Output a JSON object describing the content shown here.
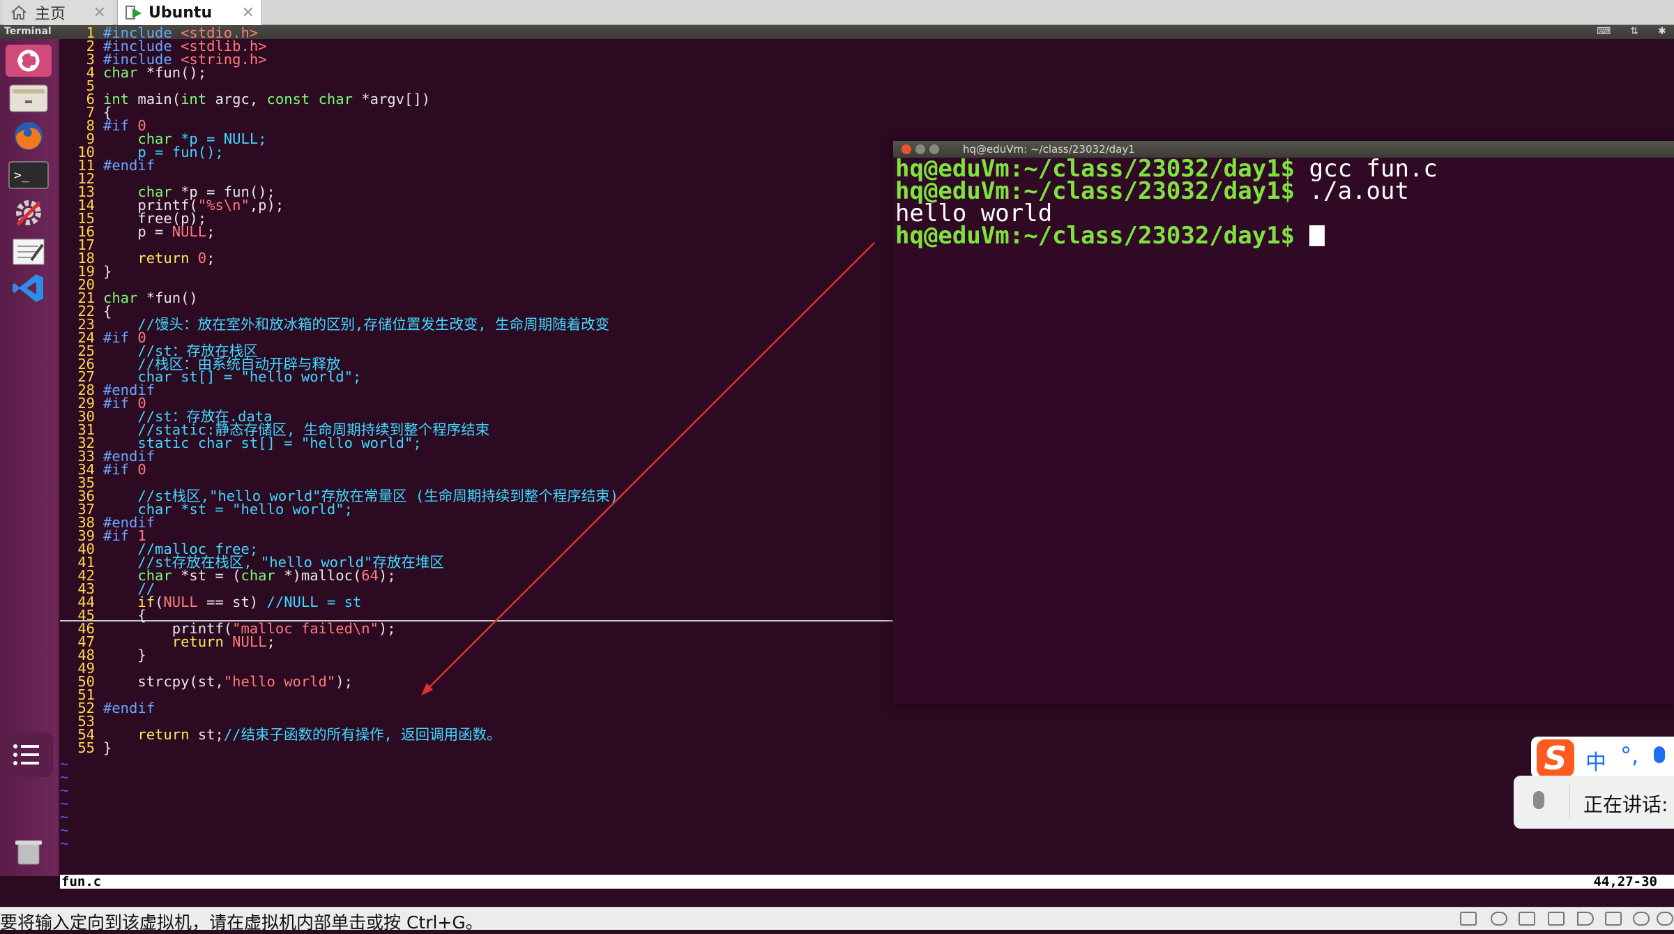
{
  "tabs": [
    {
      "label": "主页",
      "active": false
    },
    {
      "label": "Ubuntu",
      "active": true
    }
  ],
  "top_panel": {
    "title": "Terminal"
  },
  "launcher": {
    "items": [
      "ubuntu-dash-icon",
      "files-icon",
      "firefox-icon",
      "terminal-icon",
      "settings-icon",
      "text-editor-icon",
      "vscode-icon",
      "trash-icon"
    ]
  },
  "vim": {
    "lines": [
      {
        "n": "1",
        "spans": [
          {
            "t": "#include ",
            "c": "pre"
          },
          {
            "t": "<stdio.h>",
            "c": "str"
          }
        ]
      },
      {
        "n": "2",
        "spans": [
          {
            "t": "#include ",
            "c": "pre"
          },
          {
            "t": "<stdlib.h>",
            "c": "str"
          }
        ]
      },
      {
        "n": "3",
        "spans": [
          {
            "t": "#include ",
            "c": "pre"
          },
          {
            "t": "<string.h>",
            "c": "str"
          }
        ]
      },
      {
        "n": "4",
        "spans": [
          {
            "t": "char",
            "c": "type"
          },
          {
            "t": " *fun();",
            "c": ""
          }
        ]
      },
      {
        "n": "5",
        "spans": []
      },
      {
        "n": "6",
        "spans": [
          {
            "t": "int",
            "c": "type"
          },
          {
            "t": " main(",
            "c": ""
          },
          {
            "t": "int",
            "c": "type"
          },
          {
            "t": " argc, ",
            "c": ""
          },
          {
            "t": "const char",
            "c": "type"
          },
          {
            "t": " *argv[])",
            "c": ""
          }
        ]
      },
      {
        "n": "7",
        "spans": [
          {
            "t": "{",
            "c": ""
          }
        ]
      },
      {
        "n": "8",
        "spans": [
          {
            "t": "#if ",
            "c": "pre"
          },
          {
            "t": "0",
            "c": "str"
          }
        ]
      },
      {
        "n": "9",
        "spans": [
          {
            "t": "    ",
            "c": ""
          },
          {
            "t": "char",
            "c": "type"
          },
          {
            "t": " *p = NULL;",
            "c": "com"
          }
        ]
      },
      {
        "n": "10",
        "spans": [
          {
            "t": "    p = fun();",
            "c": "com"
          }
        ]
      },
      {
        "n": "11",
        "spans": [
          {
            "t": "#endif",
            "c": "pre"
          }
        ]
      },
      {
        "n": "12",
        "spans": []
      },
      {
        "n": "13",
        "spans": [
          {
            "t": "    ",
            "c": ""
          },
          {
            "t": "char",
            "c": "type"
          },
          {
            "t": " *p = fun();",
            "c": ""
          }
        ]
      },
      {
        "n": "14",
        "spans": [
          {
            "t": "    printf(",
            "c": ""
          },
          {
            "t": "\"%s\\n\"",
            "c": "str"
          },
          {
            "t": ",p);",
            "c": ""
          }
        ]
      },
      {
        "n": "15",
        "spans": [
          {
            "t": "    free(p);",
            "c": ""
          }
        ]
      },
      {
        "n": "16",
        "spans": [
          {
            "t": "    p = ",
            "c": ""
          },
          {
            "t": "NULL",
            "c": "str"
          },
          {
            "t": ";",
            "c": ""
          }
        ]
      },
      {
        "n": "17",
        "spans": []
      },
      {
        "n": "18",
        "spans": [
          {
            "t": "    ",
            "c": ""
          },
          {
            "t": "return",
            "c": "kw"
          },
          {
            "t": " ",
            "c": ""
          },
          {
            "t": "0",
            "c": "str"
          },
          {
            "t": ";",
            "c": ""
          }
        ]
      },
      {
        "n": "19",
        "spans": [
          {
            "t": "}",
            "c": ""
          }
        ]
      },
      {
        "n": "20",
        "spans": []
      },
      {
        "n": "21",
        "spans": [
          {
            "t": "char",
            "c": "type"
          },
          {
            "t": " *fun()",
            "c": ""
          }
        ]
      },
      {
        "n": "22",
        "spans": [
          {
            "t": "{",
            "c": ""
          }
        ]
      },
      {
        "n": "23",
        "spans": [
          {
            "t": "    //馒头：放在室外和放冰箱的区别,存储位置发生改变, 生命周期随着改变",
            "c": "com"
          }
        ]
      },
      {
        "n": "24",
        "spans": [
          {
            "t": "#if ",
            "c": "pre"
          },
          {
            "t": "0",
            "c": "str"
          }
        ]
      },
      {
        "n": "25",
        "spans": [
          {
            "t": "    //st：存放在栈区",
            "c": "com"
          }
        ]
      },
      {
        "n": "26",
        "spans": [
          {
            "t": "    //栈区：由系统自动开辟与释放",
            "c": "com"
          }
        ]
      },
      {
        "n": "27",
        "spans": [
          {
            "t": "    char st[] = \"hello world\";",
            "c": "com"
          }
        ]
      },
      {
        "n": "28",
        "spans": [
          {
            "t": "#endif",
            "c": "pre"
          }
        ]
      },
      {
        "n": "29",
        "spans": [
          {
            "t": "#if ",
            "c": "pre"
          },
          {
            "t": "0",
            "c": "str"
          }
        ]
      },
      {
        "n": "30",
        "spans": [
          {
            "t": "    //st：存放在.data",
            "c": "com"
          }
        ]
      },
      {
        "n": "31",
        "spans": [
          {
            "t": "    //static:静态存储区, 生命周期持续到整个程序结束",
            "c": "com"
          }
        ]
      },
      {
        "n": "32",
        "spans": [
          {
            "t": "    static char st[] = \"hello world\";",
            "c": "com"
          }
        ]
      },
      {
        "n": "33",
        "spans": [
          {
            "t": "#endif",
            "c": "pre"
          }
        ]
      },
      {
        "n": "34",
        "spans": [
          {
            "t": "#if ",
            "c": "pre"
          },
          {
            "t": "0",
            "c": "str"
          }
        ]
      },
      {
        "n": "35",
        "spans": []
      },
      {
        "n": "36",
        "spans": [
          {
            "t": "    //st栈区,\"hello world\"存放在常量区 (生命周期持续到整个程序结束)",
            "c": "com"
          }
        ]
      },
      {
        "n": "37",
        "spans": [
          {
            "t": "    char *st = \"hello world\";",
            "c": "com"
          }
        ]
      },
      {
        "n": "38",
        "spans": [
          {
            "t": "#endif",
            "c": "pre"
          }
        ]
      },
      {
        "n": "39",
        "spans": [
          {
            "t": "#if ",
            "c": "pre"
          },
          {
            "t": "1",
            "c": "str"
          }
        ]
      },
      {
        "n": "40",
        "spans": [
          {
            "t": "    //malloc free;",
            "c": "com"
          }
        ]
      },
      {
        "n": "41",
        "spans": [
          {
            "t": "    //st存放在栈区, \"hello world\"存放在堆区",
            "c": "com"
          }
        ]
      },
      {
        "n": "42",
        "spans": [
          {
            "t": "    ",
            "c": ""
          },
          {
            "t": "char",
            "c": "type"
          },
          {
            "t": " *st = (",
            "c": ""
          },
          {
            "t": "char",
            "c": "type"
          },
          {
            "t": " *)malloc(",
            "c": ""
          },
          {
            "t": "64",
            "c": "str"
          },
          {
            "t": ");",
            "c": ""
          }
        ]
      },
      {
        "n": "43",
        "spans": [
          {
            "t": "    //",
            "c": "com"
          }
        ]
      },
      {
        "n": "44",
        "spans": [
          {
            "t": "    ",
            "c": ""
          },
          {
            "t": "if",
            "c": "kw"
          },
          {
            "t": "(",
            "c": ""
          },
          {
            "t": "NULL",
            "c": "str"
          },
          {
            "t": " == st) ",
            "c": ""
          },
          {
            "t": "//NULL = st",
            "c": "com"
          }
        ]
      },
      {
        "n": "45",
        "spans": [
          {
            "t": "    {",
            "c": ""
          }
        ]
      },
      {
        "n": "46",
        "spans": [
          {
            "t": "        printf(",
            "c": ""
          },
          {
            "t": "\"malloc failed\\n\"",
            "c": "str"
          },
          {
            "t": ");",
            "c": ""
          }
        ]
      },
      {
        "n": "47",
        "spans": [
          {
            "t": "        ",
            "c": ""
          },
          {
            "t": "return",
            "c": "kw"
          },
          {
            "t": " ",
            "c": ""
          },
          {
            "t": "NULL",
            "c": "str"
          },
          {
            "t": ";",
            "c": ""
          }
        ]
      },
      {
        "n": "48",
        "spans": [
          {
            "t": "    }",
            "c": ""
          }
        ]
      },
      {
        "n": "49",
        "spans": []
      },
      {
        "n": "50",
        "spans": [
          {
            "t": "    strcpy(st,",
            "c": ""
          },
          {
            "t": "\"hello world\"",
            "c": "str"
          },
          {
            "t": ");",
            "c": ""
          }
        ]
      },
      {
        "n": "51",
        "spans": []
      },
      {
        "n": "52",
        "spans": [
          {
            "t": "#endif",
            "c": "pre"
          }
        ]
      },
      {
        "n": "53",
        "spans": []
      },
      {
        "n": "54",
        "spans": [
          {
            "t": "    ",
            "c": ""
          },
          {
            "t": "return",
            "c": "kw"
          },
          {
            "t": " st;",
            "c": ""
          },
          {
            "t": "//结束子函数的所有操作, 返回调用函数。",
            "c": "com"
          }
        ]
      },
      {
        "n": "55",
        "spans": [
          {
            "t": "}",
            "c": ""
          }
        ]
      }
    ],
    "tilde": "~",
    "tilde_count": 7,
    "status": {
      "filename": "fun.c",
      "position": "44,27-30"
    }
  },
  "terminal": {
    "title": "hq@eduVm: ~/class/23032/day1",
    "lines": [
      {
        "prompt": "hq@eduVm:~/class/23032/day1$",
        "cmd": " gcc fun.c"
      },
      {
        "prompt": "hq@eduVm:~/class/23032/day1$",
        "cmd": " ./a.out"
      },
      {
        "prompt": "",
        "cmd": "hello world"
      },
      {
        "prompt": "hq@eduVm:~/class/23032/day1$",
        "cmd": " ",
        "cursor": true
      }
    ]
  },
  "ime": {
    "logo": "S",
    "mode": "中",
    "punct": "°,",
    "speech_text": "正在讲话:"
  },
  "vm_status": {
    "message": "要将输入定向到该虚拟机，请在虚拟机内部单击或按 Ctrl+G。"
  },
  "colors": {
    "accent_arrow": "#e03030",
    "prompt": "#7fe33f",
    "terminal_bg": "#300a24"
  }
}
